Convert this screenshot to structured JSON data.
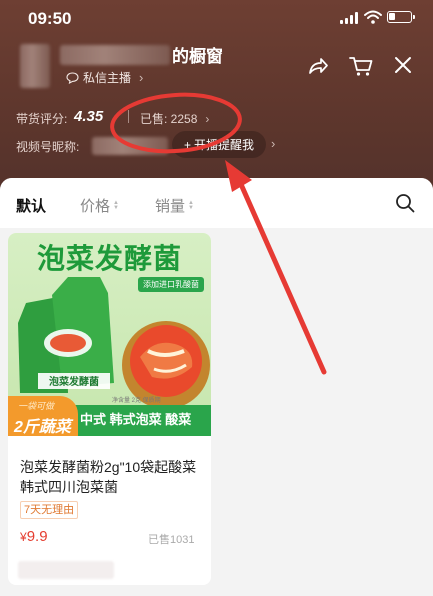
{
  "status_bar": {
    "time": "09:50"
  },
  "header": {
    "shop_title_suffix": "的橱窗",
    "chat_label": "私信主播",
    "score_label": "带货评分:",
    "score_value": "4.35",
    "sold_label": "已售: 2258",
    "video_id_label": "视频号昵称:",
    "remind_button": "开播提醒我",
    "remind_plus": "+"
  },
  "sort_bar": {
    "tabs": [
      {
        "label": "默认",
        "active": true
      },
      {
        "label": "价格",
        "active": false
      },
      {
        "label": "销量",
        "active": false
      }
    ]
  },
  "product": {
    "image_title": "泡菜发酵菌",
    "image_badge": "添加进口乳酸菌",
    "image_tag_small": "一袋可做",
    "image_tag_main": "2斤蔬菜",
    "image_bottom_text": "中式 韩式泡菜 酸菜",
    "image_spec": "净含量   2克   保质期",
    "name": "泡菜发酵菌粉2g\"10袋起酸菜韩式四川泡菜菌",
    "return_policy": "7天无理由",
    "price_symbol": "¥",
    "price_value": "9.9",
    "sold": "已售1031"
  },
  "colors": {
    "header_bg": "#6e3f33",
    "price_red": "#e53d2f",
    "annotation_red": "#e63a34",
    "product_green": "#2aa54b"
  },
  "icons": [
    "share-icon",
    "cart-icon",
    "close-icon",
    "search-icon",
    "chat-icon"
  ]
}
